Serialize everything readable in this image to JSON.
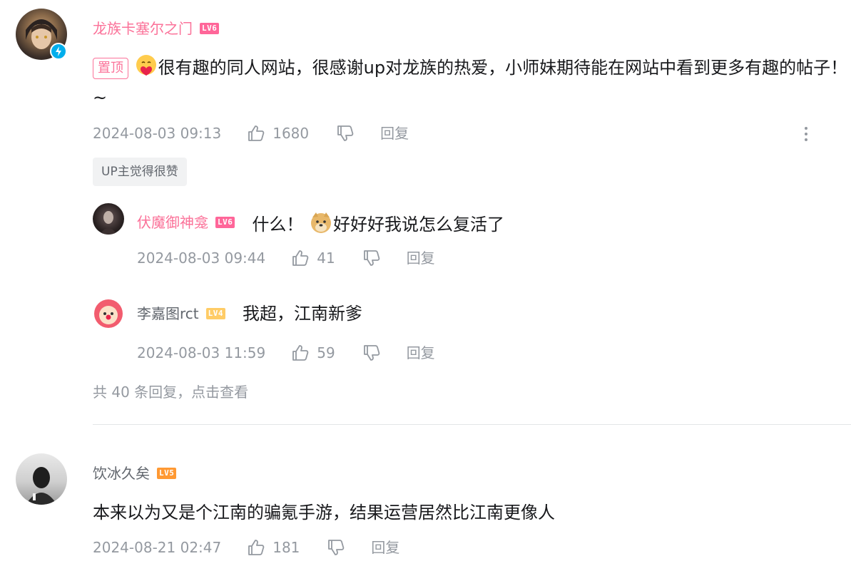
{
  "comment1": {
    "username": "龙族卡塞尔之门",
    "level": "LV6",
    "pinned_label": "置顶",
    "text": "很有趣的同人网站，很感谢up对龙族的热爱，小师妹期待能在网站中看到更多有趣的帖子！~",
    "time": "2024-08-03 09:13",
    "likes": "1680",
    "reply_label": "回复",
    "up_liked": "UP主觉得很赞",
    "replies": [
      {
        "username": "伏魔御神龛",
        "level": "LV6",
        "text_prefix": "什么！",
        "text": "好好好我说怎么复活了",
        "time": "2024-08-03 09:44",
        "likes": "41",
        "reply_label": "回复"
      },
      {
        "username": "李嘉图rct",
        "level": "LV4",
        "text": "我超，江南新爹",
        "time": "2024-08-03 11:59",
        "likes": "59",
        "reply_label": "回复"
      }
    ],
    "view_more": "共 40 条回复，点击查看"
  },
  "comment2": {
    "username": "饮冰久矣",
    "level": "LV5",
    "text": "本来以为又是个江南的骗氪手游，结果运营居然比江南更像人",
    "time": "2024-08-21 02:47",
    "likes": "181",
    "reply_label": "回复"
  },
  "colors": {
    "pink": "#fb7299",
    "lv6": "#ff6699",
    "lv5": "#ff9933",
    "lv4": "#ffcc66",
    "meta": "#9499a0"
  },
  "icons": [
    "verified-bolt-icon",
    "like-icon",
    "dislike-icon",
    "more-icon",
    "heart-hug-emoji",
    "doge-emoji"
  ]
}
